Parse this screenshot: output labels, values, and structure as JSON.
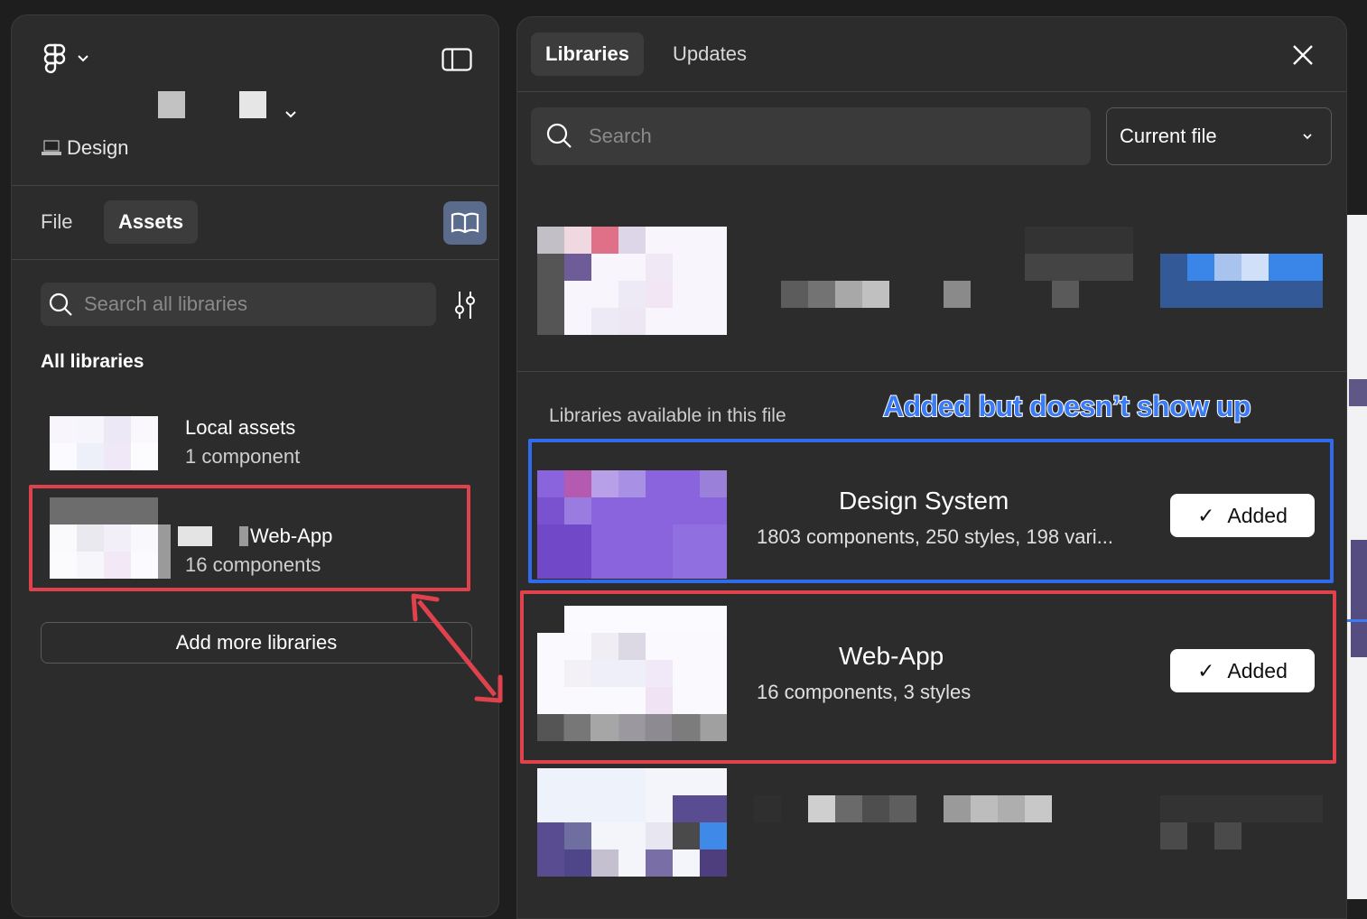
{
  "left": {
    "page_name": "Design",
    "tabs": [
      {
        "label": "File"
      },
      {
        "label": "Assets"
      }
    ],
    "search_placeholder": "Search all libraries",
    "section_title": "All libraries",
    "libraries": [
      {
        "name": "Local assets",
        "detail": "1 component"
      },
      {
        "name": "Web-App",
        "detail": "16 components"
      }
    ],
    "add_more_label": "Add more libraries"
  },
  "right": {
    "tabs": [
      {
        "label": "Libraries"
      },
      {
        "label": "Updates"
      }
    ],
    "search_placeholder": "Search",
    "scope_dropdown": "Current file",
    "section_label": "Libraries available in this file",
    "libraries": [
      {
        "name": "Design System",
        "detail": "1803 components, 250 styles, 198 vari...",
        "status": "Added"
      },
      {
        "name": "Web-App",
        "detail": "16 components, 3 styles",
        "status": "Added"
      }
    ],
    "check_glyph": "✓"
  },
  "annotation": {
    "text": "Added but doesn’t show up"
  },
  "colors": {
    "panel_bg": "#2c2c2c",
    "highlight_red": "#e0424d",
    "highlight_blue": "#2f6bea",
    "annotation_blue": "#3b7cf6"
  }
}
